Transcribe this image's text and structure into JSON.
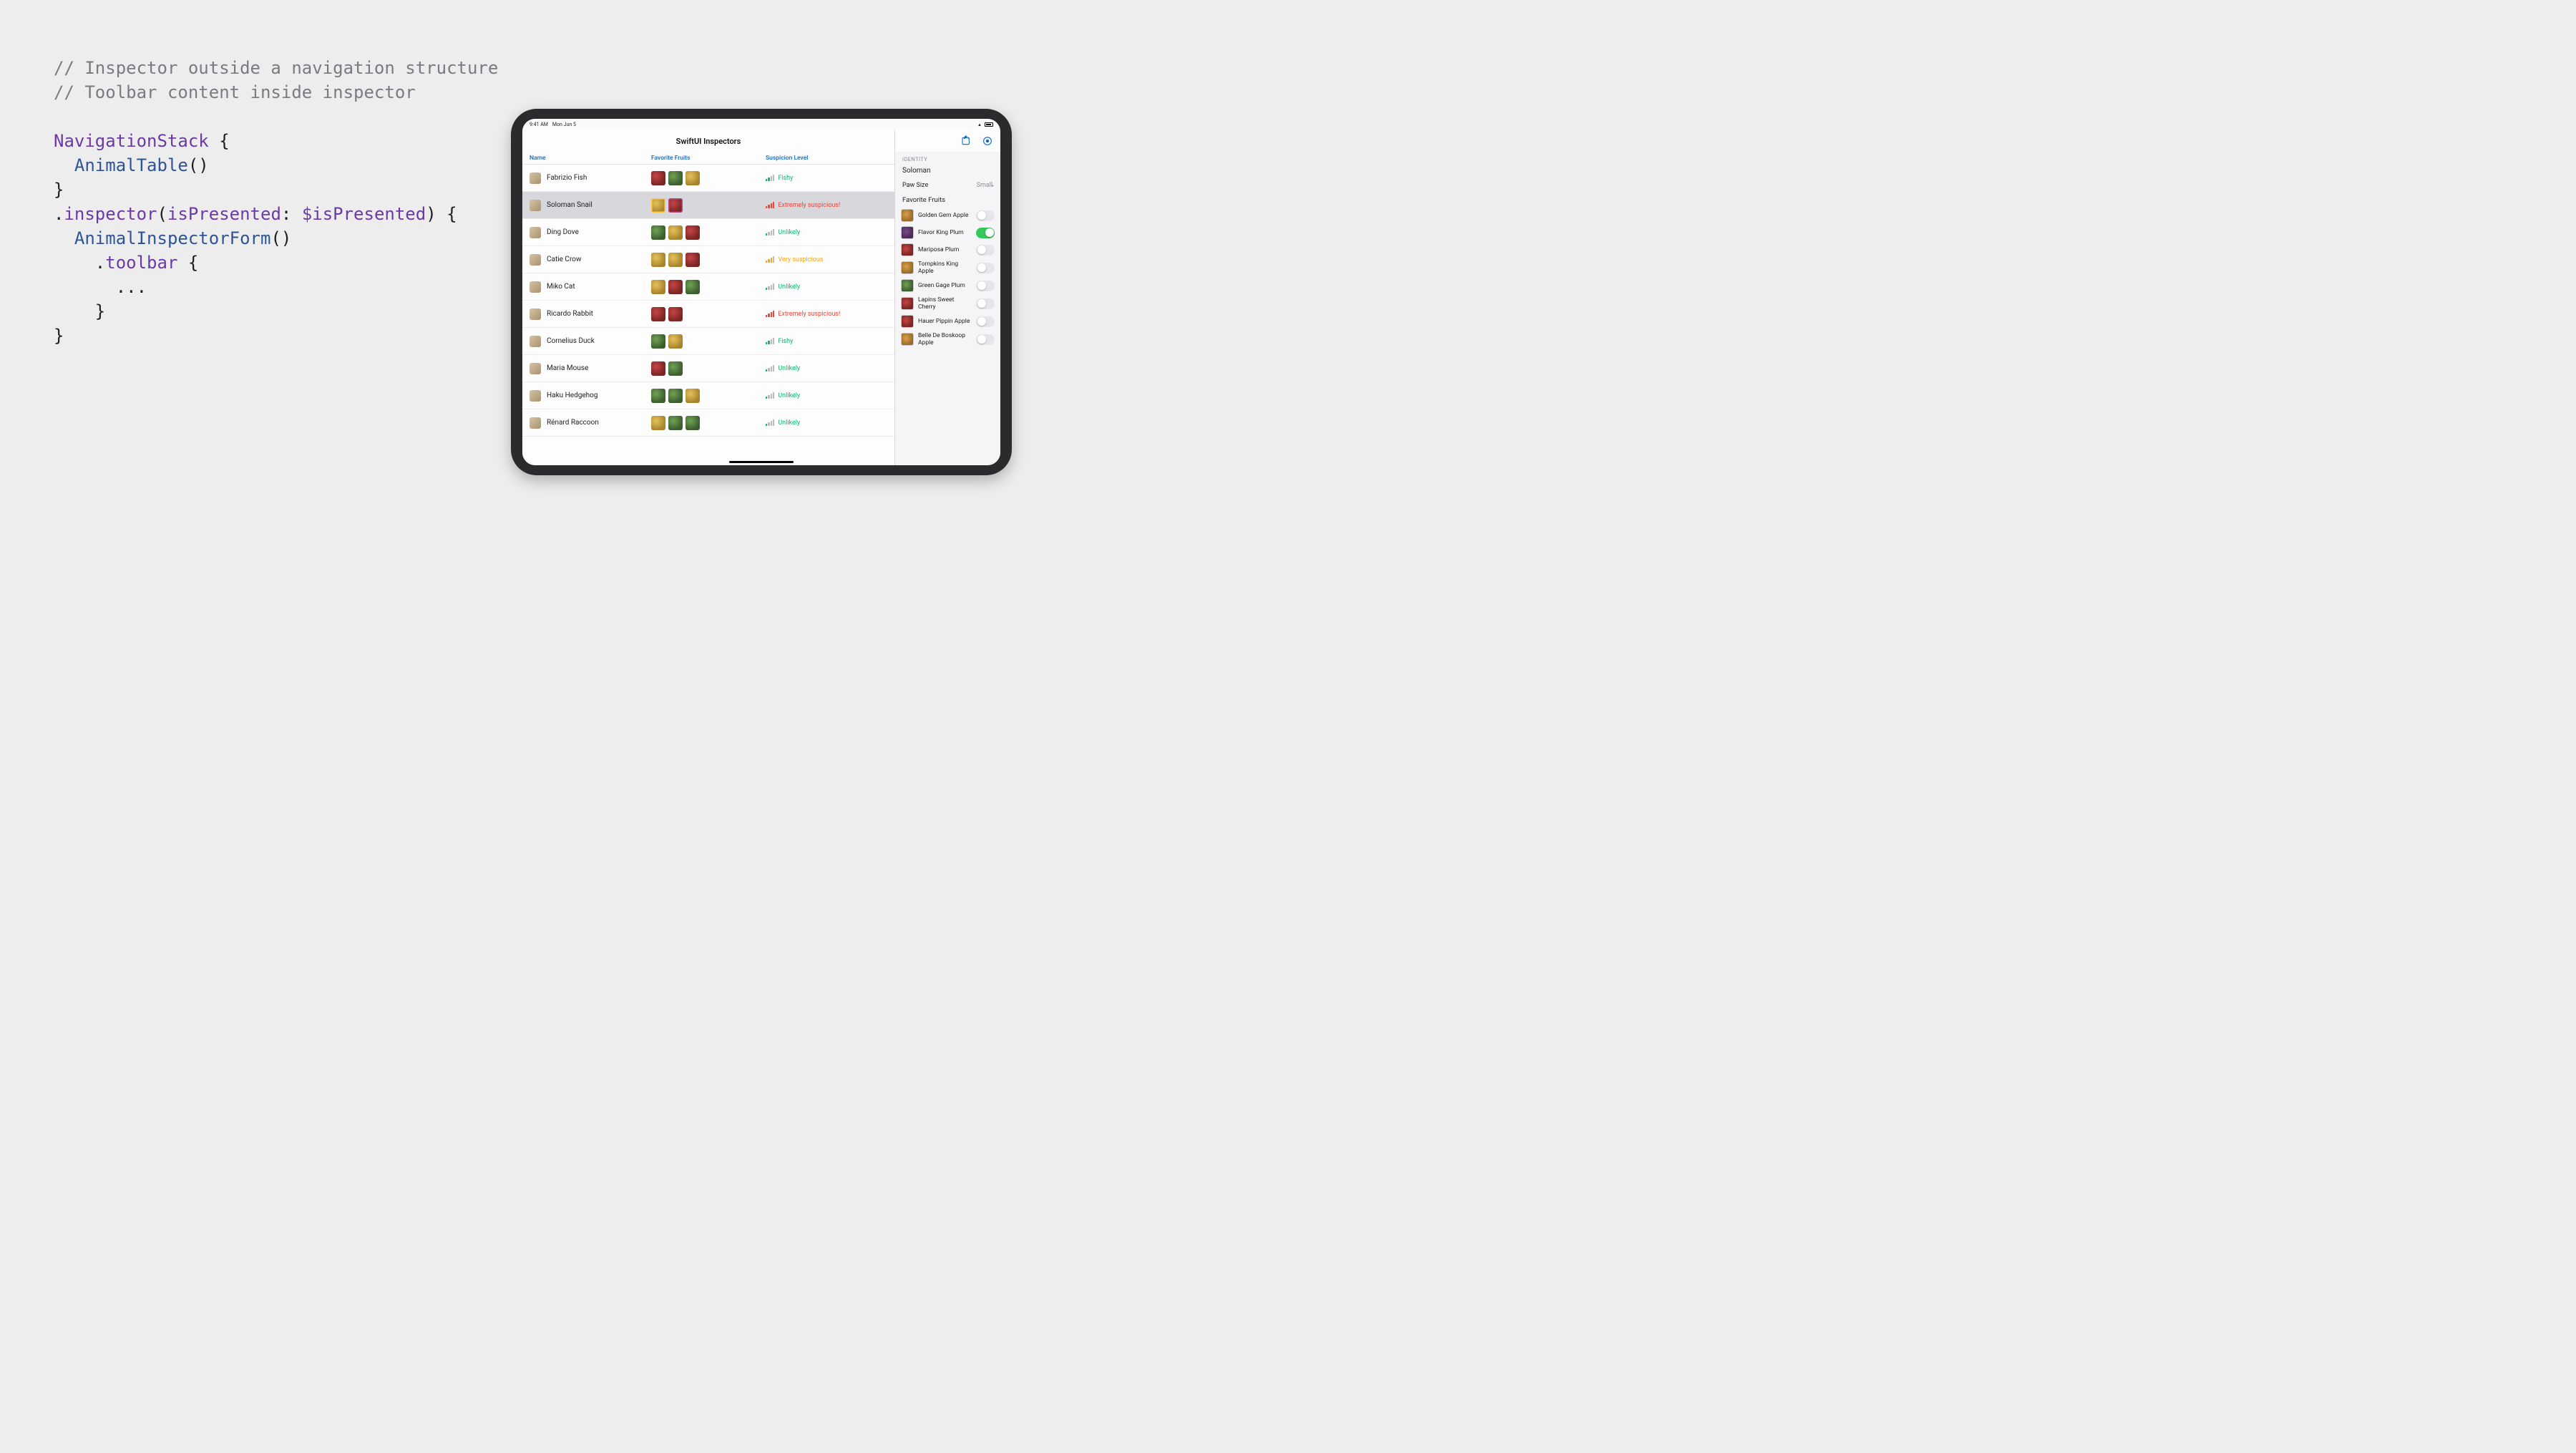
{
  "code": {
    "comment1": "// Inspector outside a navigation structure",
    "comment2": "// Toolbar content inside inspector",
    "navStack": "NavigationStack",
    "animalTable": "AnimalTable",
    "inspectorFn": "inspector",
    "argLabel": "isPresented",
    "argVar": "$isPresented",
    "inspectorForm": "AnimalInspectorForm",
    "toolbarFn": "toolbar",
    "ellipsis": "..."
  },
  "statusbar": {
    "time": "9:41 AM",
    "date": "Mon Jun 5"
  },
  "navbar": {
    "title": "SwiftUI Inspectors"
  },
  "columns": {
    "name": "Name",
    "fruits": "Favorite Fruits",
    "suspicion": "Suspicion Level"
  },
  "rows": [
    {
      "name": "Fabrizio Fish",
      "fruits": [
        "r",
        "g",
        "y"
      ],
      "level": 2,
      "label": "Fishy",
      "selected": false
    },
    {
      "name": "Soloman Snail",
      "fruits": [
        "y",
        "p"
      ],
      "hi": [
        0,
        1
      ],
      "level": 4,
      "label": "Extremely suspicious!",
      "selected": true
    },
    {
      "name": "Ding Dove",
      "fruits": [
        "g",
        "y",
        "r"
      ],
      "level": 1,
      "label": "Unlikely",
      "selected": false
    },
    {
      "name": "Catie Crow",
      "fruits": [
        "y",
        "y",
        "r"
      ],
      "level": 3,
      "label": "Very suspicious",
      "selected": false
    },
    {
      "name": "Miko Cat",
      "fruits": [
        "y",
        "r",
        "g"
      ],
      "level": 1,
      "label": "Unlikely",
      "selected": false
    },
    {
      "name": "Ricardo Rabbit",
      "fruits": [
        "r",
        "r"
      ],
      "level": 4,
      "label": "Extremely suspicious!",
      "selected": false
    },
    {
      "name": "Cornelius Duck",
      "fruits": [
        "g",
        "y"
      ],
      "level": 2,
      "label": "Fishy",
      "selected": false
    },
    {
      "name": "Maria Mouse",
      "fruits": [
        "r",
        "g"
      ],
      "level": 1,
      "label": "Unlikely",
      "selected": false
    },
    {
      "name": "Haku Hedgehog",
      "fruits": [
        "g",
        "g",
        "y"
      ],
      "level": 1,
      "label": "Unlikely",
      "selected": false
    },
    {
      "name": "Rénard Raccoon",
      "fruits": [
        "y",
        "g",
        "g"
      ],
      "level": 1,
      "label": "Unlikely",
      "selected": false
    }
  ],
  "inspector": {
    "section_identity": "IDENTITY",
    "name_value": "Soloman",
    "paw_size_label": "Paw Size",
    "paw_size_value": "Small",
    "fav_label": "Favorite Fruits",
    "fruits": [
      {
        "name": "Golden Gem Apple",
        "sw": "y",
        "on": false
      },
      {
        "name": "Flavor King Plum",
        "sw": "p",
        "on": true
      },
      {
        "name": "Mariposa Plum",
        "sw": "r",
        "on": false
      },
      {
        "name": "Tompkins King Apple",
        "sw": "y",
        "on": false
      },
      {
        "name": "Green Gage Plum",
        "sw": "g",
        "on": false
      },
      {
        "name": "Lapins Sweet Cherry",
        "sw": "r",
        "on": false
      },
      {
        "name": "Hauer Pippin Apple",
        "sw": "r",
        "on": false
      },
      {
        "name": "Belle De Boskoop Apple",
        "sw": "y",
        "on": false
      }
    ]
  }
}
